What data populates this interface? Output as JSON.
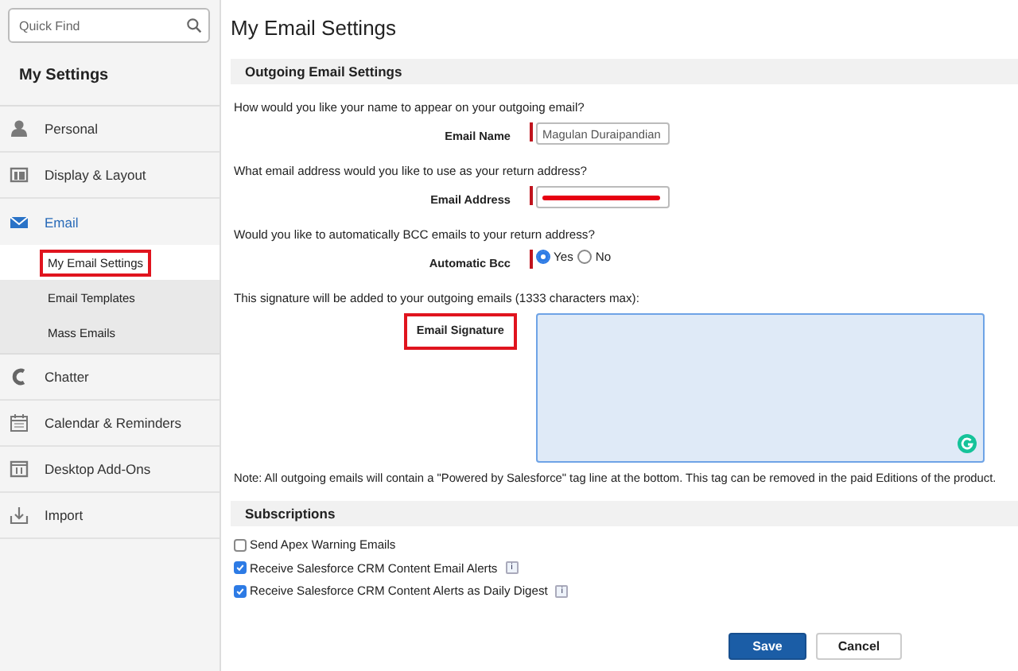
{
  "sidebar": {
    "search": {
      "placeholder": "Quick Find"
    },
    "heading": "My Settings",
    "items": [
      {
        "label": "Personal",
        "selected": false
      },
      {
        "label": "Display & Layout",
        "selected": false
      },
      {
        "label": "Email",
        "selected": true,
        "children": [
          {
            "label": "My Email Settings",
            "selected": true,
            "highlighted": true
          },
          {
            "label": "Email Templates",
            "selected": false,
            "highlighted": false
          },
          {
            "label": "Mass Emails",
            "selected": false,
            "highlighted": false
          }
        ]
      },
      {
        "label": "Chatter",
        "selected": false
      },
      {
        "label": "Calendar & Reminders",
        "selected": false
      },
      {
        "label": "Desktop Add-Ons",
        "selected": false
      },
      {
        "label": "Import",
        "selected": false
      }
    ]
  },
  "page_title": "My Email Settings",
  "outgoing": {
    "heading": "Outgoing Email Settings",
    "fields": [
      {
        "kind": "text",
        "prompt": "How would you like your name to appear on your outgoing email?",
        "label": "Email Name",
        "required": true,
        "highlighted": false,
        "value": "Magulan Duraipandian"
      },
      {
        "kind": "redacted",
        "prompt": "What email address would you like to use as your return address?",
        "label": "Email Address",
        "required": true,
        "highlighted": false
      },
      {
        "kind": "radio",
        "prompt": "Would you like to automatically BCC emails to your return address?",
        "label": "Automatic Bcc",
        "required": true,
        "highlighted": false,
        "options": [
          {
            "label": "Yes",
            "selected": true
          },
          {
            "label": "No",
            "selected": false
          }
        ]
      },
      {
        "kind": "textarea",
        "prompt": "This signature will be added to your outgoing emails (1333 characters max):",
        "label": "Email Signature",
        "required": false,
        "highlighted": true
      }
    ],
    "note": "Note: All outgoing emails will contain a \"Powered by Salesforce\" tag line at the bottom. This tag can be removed in the paid Editions of the product."
  },
  "subscriptions": {
    "heading": "Subscriptions",
    "items": [
      {
        "label": "Send Apex Warning Emails",
        "checked": false
      },
      {
        "label": "Receive Salesforce CRM Content Email Alerts",
        "checked": true,
        "info": "i"
      },
      {
        "label": "Receive Salesforce CRM Content Alerts as Daily Digest",
        "checked": true,
        "info": "i"
      }
    ]
  },
  "buttons": [
    {
      "label": "Save",
      "kind": "primary"
    },
    {
      "label": "Cancel",
      "kind": "secondary"
    }
  ]
}
